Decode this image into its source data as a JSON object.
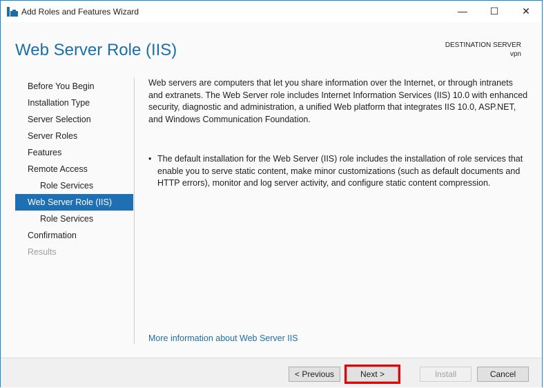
{
  "window": {
    "title": "Add Roles and Features Wizard",
    "minimize": "—",
    "maximize": "☐",
    "close": "✕"
  },
  "header": {
    "title": "Web Server Role (IIS)",
    "dest_label": "DESTINATION SERVER",
    "dest_value": "vpn"
  },
  "nav": [
    {
      "label": "Before You Begin"
    },
    {
      "label": "Installation Type"
    },
    {
      "label": "Server Selection"
    },
    {
      "label": "Server Roles"
    },
    {
      "label": "Features"
    },
    {
      "label": "Remote Access"
    },
    {
      "label": "Role Services"
    },
    {
      "label": "Web Server Role (IIS)"
    },
    {
      "label": "Role Services"
    },
    {
      "label": "Confirmation"
    },
    {
      "label": "Results"
    }
  ],
  "content": {
    "intro": "Web servers are computers that let you share information over the Internet, or through intranets and extranets. The Web Server role includes Internet Information Services (IIS) 10.0 with enhanced security, diagnostic and administration, a unified Web platform that integrates IIS 10.0, ASP.NET, and Windows Communication Foundation.",
    "bullet": "The default installation for the Web Server (IIS) role includes the installation of role services that enable you to serve static content, make minor customizations (such as default documents and HTTP errors), monitor and log server activity, and configure static content compression.",
    "more_link": "More information about Web Server IIS"
  },
  "buttons": {
    "previous": "< Previous",
    "next": "Next >",
    "install": "Install",
    "cancel": "Cancel"
  }
}
